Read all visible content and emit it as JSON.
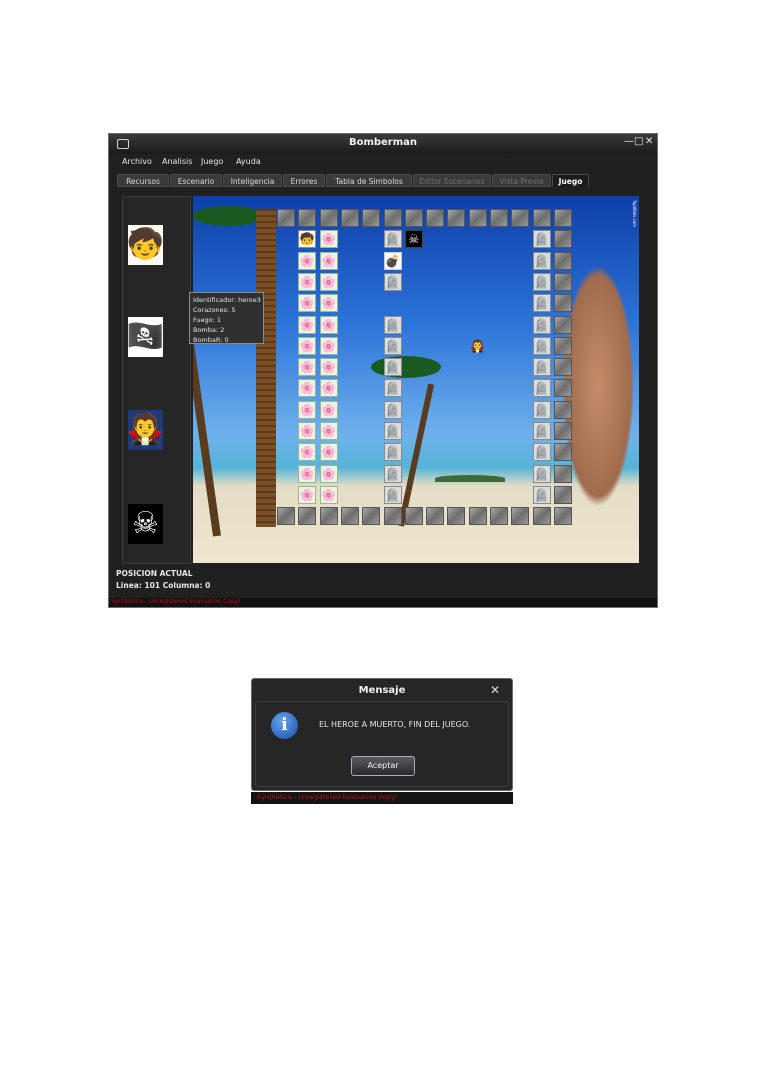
{
  "window": {
    "title": "Bomberman",
    "controls": {
      "minimize": "—",
      "maximize": "□",
      "close": "✕"
    }
  },
  "menu": [
    "Archivo",
    "Analisis",
    "Juego",
    "Ayuda"
  ],
  "tabs": [
    {
      "label": "Recursos",
      "state": "normal"
    },
    {
      "label": "Escenario",
      "state": "normal"
    },
    {
      "label": "Inteligencia",
      "state": "normal"
    },
    {
      "label": "Errores",
      "state": "normal"
    },
    {
      "label": "Tabla de Simbolos",
      "state": "normal"
    },
    {
      "label": "Editor Escenarios",
      "state": "disabled"
    },
    {
      "label": "Vista Previa",
      "state": "disabled"
    },
    {
      "label": "Juego",
      "state": "active"
    }
  ],
  "sidepanel": {
    "characters": [
      "hero-portrait-icon",
      "pirate-portrait-icon",
      "vampire-portrait-icon",
      "skull-crossbones-icon"
    ]
  },
  "tooltip": {
    "lines": [
      "Identificador: heroe3",
      "Corazones: 5",
      "Fuego: 1",
      "Bomba: 2",
      "BombaR: 0"
    ]
  },
  "board": {
    "watermark": "TopWalls.com",
    "cells": {
      "stone": "stone-block-icon",
      "flower": "flower-bush-icon",
      "grave": "gravestone-icon",
      "hero": "hero-icon",
      "skull": "skull-icon",
      "vampire": "vampire-icon",
      "bomb": "bomb-icon"
    }
  },
  "status": {
    "heading": "POSICION ACTUAL",
    "position": "Linea: 101 Columna: 0"
  },
  "eval_notice": "Synthetica - Unregistered Evaluation Copy!",
  "dialog": {
    "title": "Mensaje",
    "close": "✕",
    "message": "EL HEROE A MUERTO, FIN DEL JUEGO.",
    "button": "Aceptar",
    "icon": "info-icon",
    "notice": "Synthetica - Unregistered Evaluation Copy!"
  }
}
